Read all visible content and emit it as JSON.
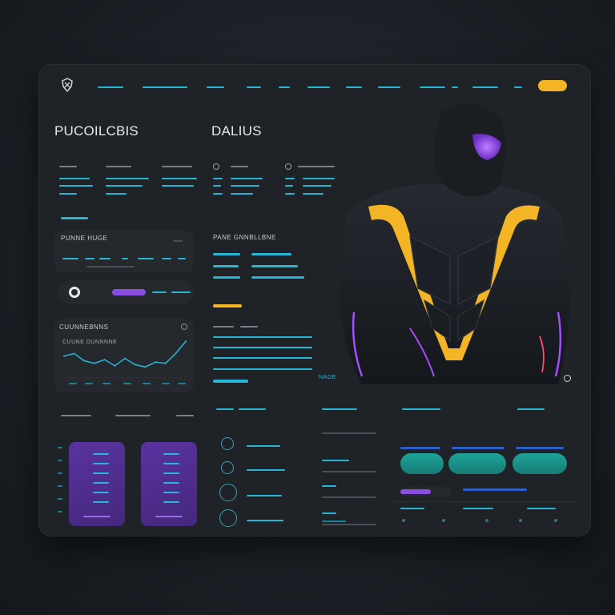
{
  "header": {
    "logo_icon": "shield-mask-icon",
    "nav_items_count_hint": "",
    "cta_color": "#f3b526"
  },
  "titles": {
    "left": "PUCOILCBIS",
    "center": "DALIUS"
  },
  "cards": {
    "stats_title": "PUNNE HUGE",
    "chart_title": "CUUNNEBNNS",
    "chart_label": "CUUNE DUNNNNE",
    "middle_title": "PANE GNNBLLBNE"
  },
  "hero": {
    "caption": "NAGE",
    "colors": {
      "accent": "#f3b526",
      "glow": "#a64dff",
      "suit": "#15181d"
    }
  },
  "chart_data": {
    "type": "line",
    "series": [
      {
        "values": [
          18,
          20,
          14,
          12,
          15,
          10,
          16,
          11,
          9,
          13,
          12,
          20,
          30
        ]
      }
    ]
  },
  "colors": {
    "panel": "#1f2226",
    "cyan": "#27b6d6",
    "purple": "#8a4fe0",
    "teal": "#1fa399",
    "yellow": "#f3b526"
  }
}
